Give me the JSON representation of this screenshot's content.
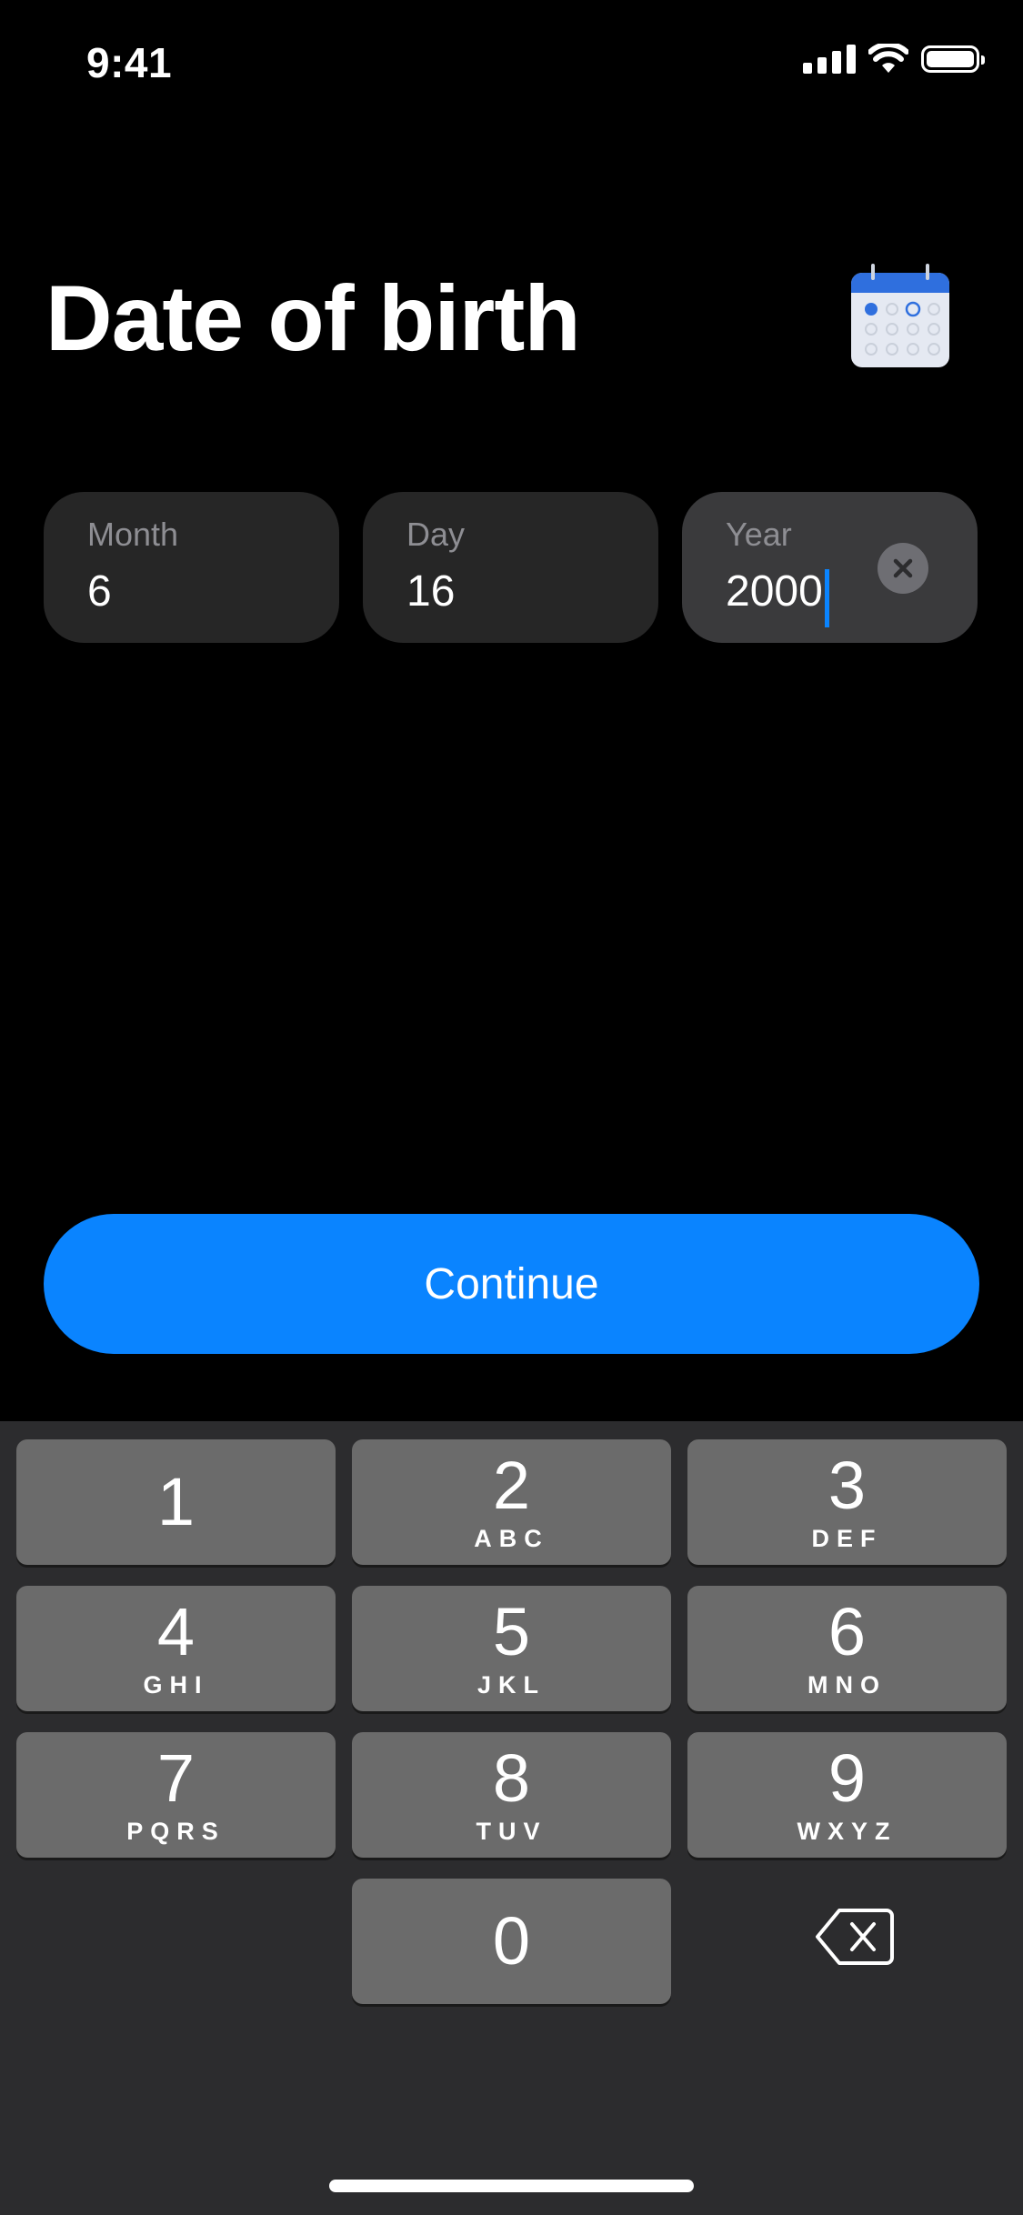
{
  "status_bar": {
    "time": "9:41"
  },
  "title": "Date of birth",
  "fields": [
    {
      "label": "Month",
      "value": "6"
    },
    {
      "label": "Day",
      "value": "16"
    },
    {
      "label": "Year",
      "value": "2000"
    }
  ],
  "continue_label": "Continue",
  "keypad": [
    {
      "digit": "1",
      "letters": ""
    },
    {
      "digit": "2",
      "letters": "ABC"
    },
    {
      "digit": "3",
      "letters": "DEF"
    },
    {
      "digit": "4",
      "letters": "GHI"
    },
    {
      "digit": "5",
      "letters": "JKL"
    },
    {
      "digit": "6",
      "letters": "MNO"
    },
    {
      "digit": "7",
      "letters": "PQRS"
    },
    {
      "digit": "8",
      "letters": "TUV"
    },
    {
      "digit": "9",
      "letters": "WXYZ"
    },
    {
      "digit": "0",
      "letters": ""
    }
  ],
  "icons": {
    "calendar": "calendar-icon",
    "clear": "clear-icon",
    "backspace": "backspace-icon"
  },
  "colors": {
    "accent": "#0a84ff",
    "background": "#000000",
    "field_bg": "#262626",
    "keypad_bg": "#2c2c2e",
    "key_bg": "#6b6b6b"
  }
}
